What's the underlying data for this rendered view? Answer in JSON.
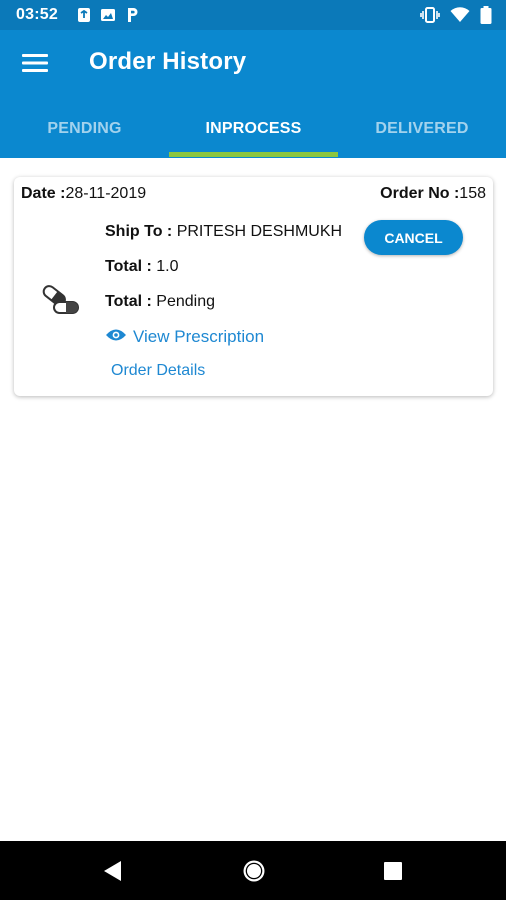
{
  "status_bar": {
    "time": "03:52",
    "left_icons": [
      "sim-toolkit-icon",
      "image-icon",
      "parking-p-icon"
    ],
    "right_icons": [
      "vibrate-icon",
      "wifi-icon",
      "battery-icon"
    ]
  },
  "app_bar": {
    "title": "Order History",
    "menu_icon": "hamburger-menu-icon",
    "background": "#0b88cf"
  },
  "tabs": [
    {
      "label": "PENDING",
      "active": false
    },
    {
      "label": "INPROCESS",
      "active": true
    },
    {
      "label": "DELIVERED",
      "active": false
    }
  ],
  "tab_indicator_color": "#8cc63f",
  "order": {
    "date_label": "Date :",
    "date_value": "28-11-2019",
    "order_no_label": "Order No :",
    "order_no_value": "158",
    "ship_to_label": "Ship To :",
    "ship_to_value": "PRITESH DESHMUKH",
    "total_label": "Total :",
    "total_value": "1.0",
    "status_label": "Total :",
    "status_value": "Pending",
    "cancel_label": "CANCEL",
    "view_prescription_label": "View Prescription",
    "order_details_label": "Order Details",
    "product_icon": "medicine-capsule-icon"
  },
  "nav_bar": {
    "back_icon": "back-triangle-icon",
    "home_icon": "home-circle-icon",
    "recent_icon": "recent-apps-square-icon"
  }
}
